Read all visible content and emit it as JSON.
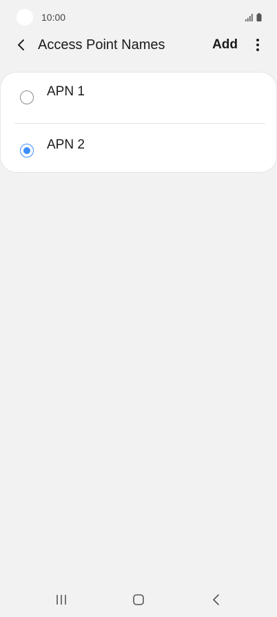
{
  "status_bar": {
    "time": "10:00"
  },
  "app_bar": {
    "title": "Access Point Names",
    "add_label": "Add"
  },
  "apn_list": {
    "items": [
      {
        "label": "APN 1",
        "selected": false
      },
      {
        "label": "APN 2",
        "selected": true
      }
    ]
  },
  "colors": {
    "accent": "#3e8ef7",
    "background": "#f2f2f2",
    "card": "#ffffff"
  },
  "icons": {
    "back": "chevron-left-icon",
    "more": "more-vertical-icon",
    "signal": "signal-icon",
    "battery": "battery-icon",
    "nav_recents": "recents-icon",
    "nav_home": "home-icon",
    "nav_back": "back-icon"
  }
}
